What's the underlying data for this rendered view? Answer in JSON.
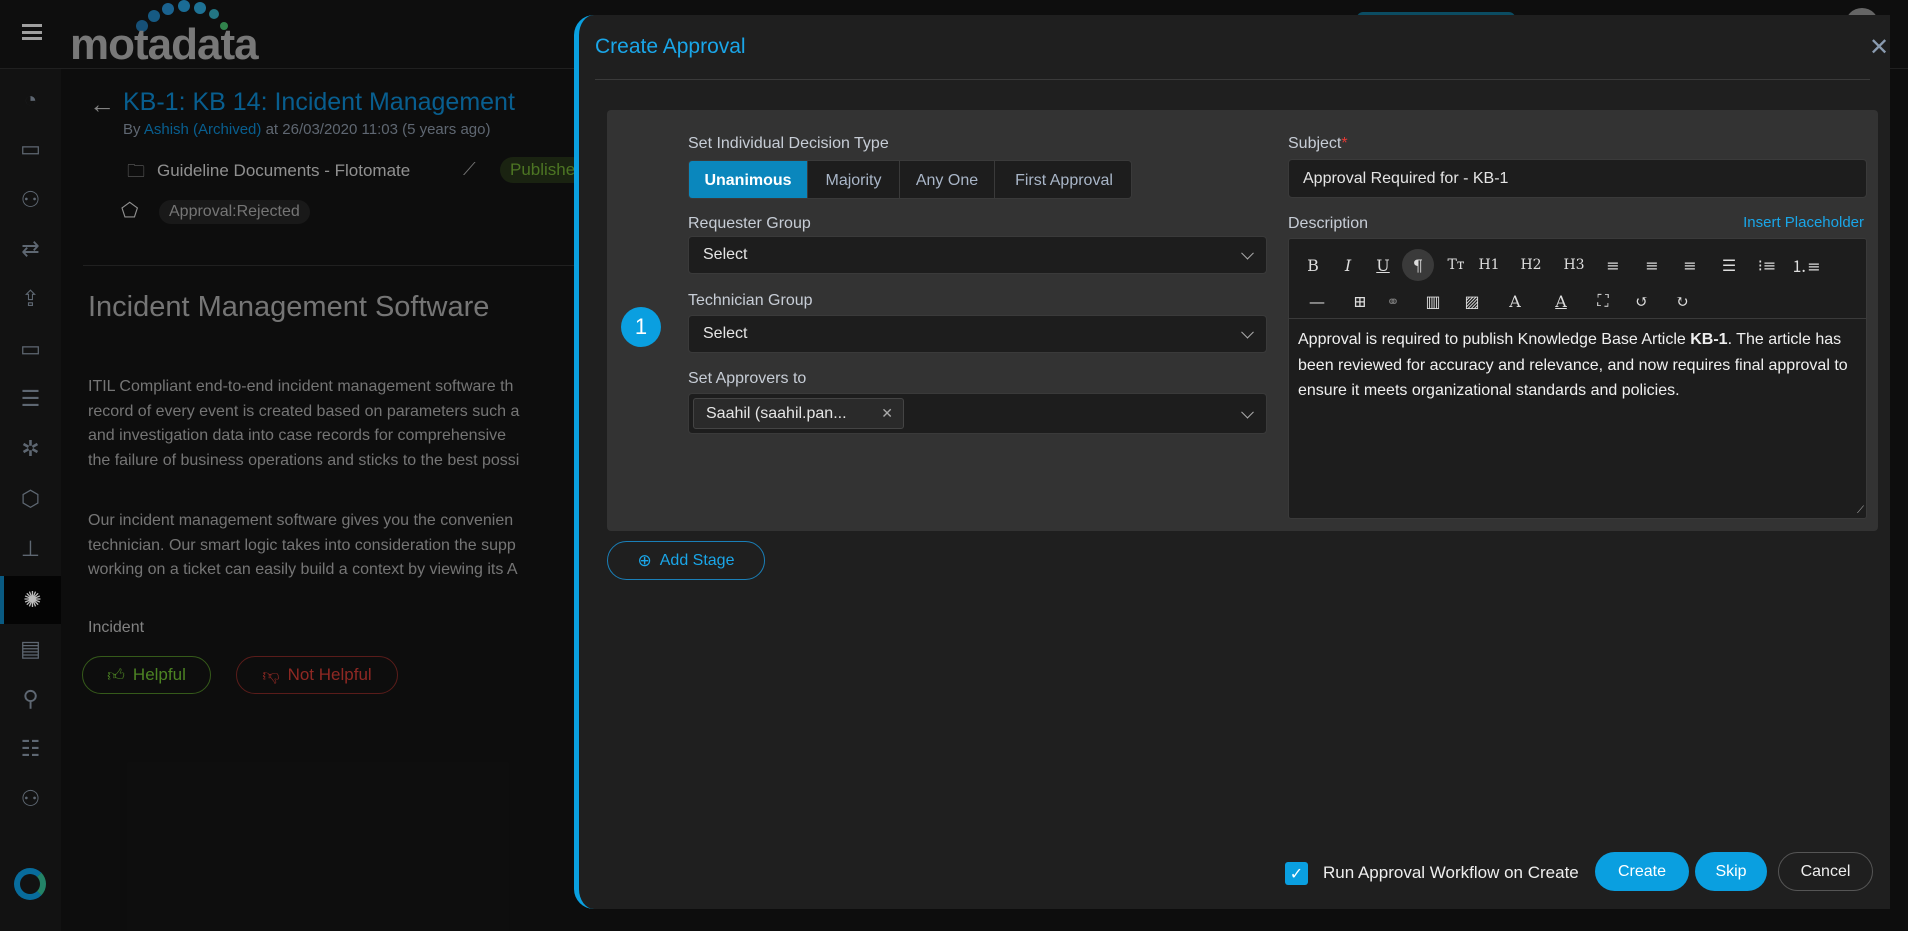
{
  "app": {
    "logo_text": "motadata",
    "menu_icon": "hamburger-icon"
  },
  "sidebar": {
    "items": [
      {
        "icon": "dashboard-icon"
      },
      {
        "icon": "ticket-icon"
      },
      {
        "icon": "problem-user-icon"
      },
      {
        "icon": "change-icon"
      },
      {
        "icon": "release-icon"
      },
      {
        "icon": "asset-laptop-icon"
      },
      {
        "icon": "cmdb-server-icon"
      },
      {
        "icon": "patch-gear-icon"
      },
      {
        "icon": "package-cube-icon"
      },
      {
        "icon": "workflow-hierarchy-icon"
      },
      {
        "icon": "knowledge-lightbulb-icon",
        "active": true
      },
      {
        "icon": "report-icon"
      },
      {
        "icon": "user-check-icon"
      },
      {
        "icon": "task-list-icon"
      },
      {
        "icon": "users-icon"
      },
      {
        "icon": "status-ring-icon"
      }
    ]
  },
  "article": {
    "title": "KB-1: KB 14: Incident Management",
    "by_prefix": "By",
    "author": "Ashish (Archived)",
    "by_suffix": "at 26/03/2020 11:03 (5 years ago)",
    "folder": "Guideline Documents - Flotomate",
    "status": "Publishe",
    "tag": "Approval:Rejected",
    "heading": "Incident Management Software",
    "para1": [
      "ITIL Compliant end-to-end incident management software th",
      "record of every event is created based on parameters such a",
      "and investigation data into case records for comprehensive",
      "the failure of business operations and sticks to the best possi"
    ],
    "para2": [
      "Our incident management software gives you the convenien",
      "technician. Our smart logic takes into consideration the supp",
      "working on a ticket can easily build a context by viewing its A"
    ],
    "category": "Incident",
    "helpful": "Helpful",
    "not_helpful": "Not Helpful"
  },
  "modal": {
    "title": "Create Approval",
    "stage_number": "1",
    "decision_type_label": "Set Individual Decision Type",
    "decision_types": [
      "Unanimous",
      "Majority",
      "Any One",
      "First Approval"
    ],
    "decision_selected": "Unanimous",
    "requester_group_label": "Requester Group",
    "requester_group_value": "Select",
    "technician_group_label": "Technician Group",
    "technician_group_value": "Select",
    "approvers_label": "Set Approvers to",
    "approver_tag": "Saahil (saahil.pan...",
    "subject_label": "Subject",
    "required_mark": "*",
    "subject_value": "Approval Required for - KB-1",
    "description_label": "Description",
    "insert_placeholder": "Insert Placeholder",
    "toolbar_row1": [
      "B",
      "I",
      "U",
      "¶",
      "Tт",
      "H1",
      "H2",
      "H3"
    ],
    "description": {
      "pre": "Approval is required to publish Knowledge Base Article ",
      "bold": "KB-1",
      "post": ". The article has been reviewed for accuracy and relevance, and now requires final approval to ensure it meets organizational standards and policies."
    },
    "add_stage": "Add Stage",
    "run_workflow_label": "Run Approval Workflow on Create",
    "run_workflow_checked": true,
    "create": "Create",
    "skip": "Skip",
    "cancel": "Cancel"
  },
  "colors": {
    "accent": "#0aa0e0",
    "title_blue": "#0a6fa8",
    "helpful": "#5a9a2a",
    "not_helpful": "#a8302a",
    "required": "#e53935"
  }
}
